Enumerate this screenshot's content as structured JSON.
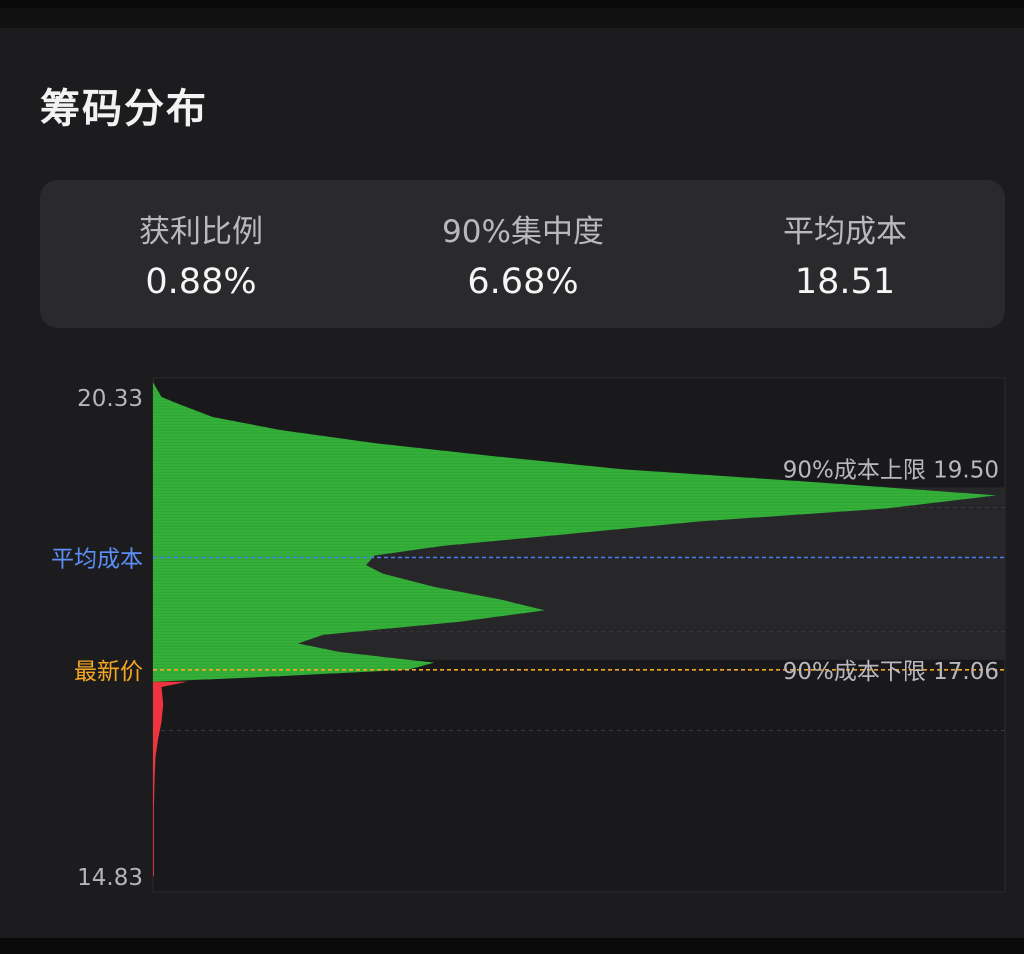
{
  "title": "筹码分布",
  "stats": [
    {
      "label": "获利比例",
      "value": "0.88%"
    },
    {
      "label": "90%集中度",
      "value": "6.68%"
    },
    {
      "label": "平均成本",
      "value": "18.51"
    }
  ],
  "colors": {
    "profit": "#35b13a",
    "loss": "#f0343f",
    "avg_line": "#4a7ff0",
    "latest_line": "#f5a623",
    "avg_label": "#5b8ef7",
    "latest_label": "#f5a623",
    "band": "#27272a"
  },
  "chart_data": {
    "type": "bar",
    "orientation": "horizontal",
    "y_axis": {
      "max": 20.33,
      "min": 14.83,
      "max_label": "20.33",
      "min_label": "14.83"
    },
    "band_90": {
      "upper": 19.5,
      "lower": 17.06,
      "upper_label": "90%成本上限 19.50",
      "lower_label": "90%成本下限 17.06"
    },
    "avg_cost": {
      "value": 18.51,
      "label": "平均成本"
    },
    "latest_price": {
      "value": 17.06,
      "label": "最新价"
    },
    "x_max": 1.0,
    "profit_profile": [
      [
        20.5,
        0.0
      ],
      [
        20.33,
        0.01
      ],
      [
        20.25,
        0.03
      ],
      [
        20.1,
        0.07
      ],
      [
        19.95,
        0.15
      ],
      [
        19.8,
        0.26
      ],
      [
        19.65,
        0.4
      ],
      [
        19.5,
        0.55
      ],
      [
        19.35,
        0.78
      ],
      [
        19.2,
        0.99
      ],
      [
        19.05,
        0.86
      ],
      [
        18.9,
        0.64
      ],
      [
        18.75,
        0.48
      ],
      [
        18.62,
        0.34
      ],
      [
        18.51,
        0.26
      ],
      [
        18.4,
        0.25
      ],
      [
        18.3,
        0.27
      ],
      [
        18.15,
        0.33
      ],
      [
        18.0,
        0.41
      ],
      [
        17.88,
        0.46
      ],
      [
        17.75,
        0.36
      ],
      [
        17.6,
        0.2
      ],
      [
        17.5,
        0.17
      ],
      [
        17.4,
        0.22
      ],
      [
        17.28,
        0.33
      ],
      [
        17.2,
        0.3
      ],
      [
        17.12,
        0.14
      ],
      [
        17.06,
        0.0
      ]
    ],
    "loss_profile": [
      [
        17.06,
        0.04
      ],
      [
        17.0,
        0.01
      ],
      [
        16.8,
        0.012
      ],
      [
        16.6,
        0.01
      ],
      [
        16.4,
        0.006
      ],
      [
        16.2,
        0.003
      ],
      [
        16.0,
        0.002
      ],
      [
        15.6,
        0.001
      ],
      [
        15.2,
        0.001
      ],
      [
        14.83,
        0.001
      ]
    ]
  }
}
